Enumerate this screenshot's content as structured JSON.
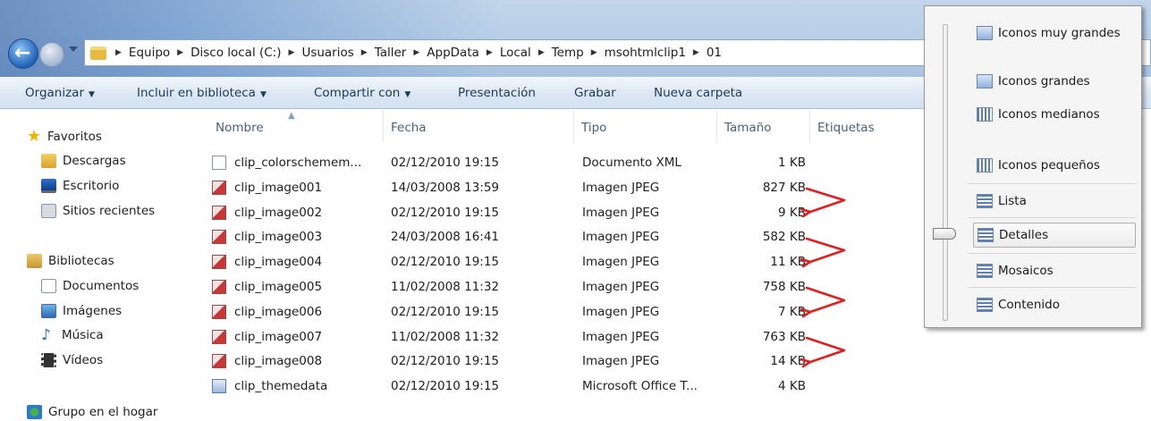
{
  "address": {
    "crumbs": [
      "Equipo",
      "Disco local (C:)",
      "Usuarios",
      "Taller",
      "AppData",
      "Local",
      "Temp",
      "msohtmlclip1",
      "01"
    ]
  },
  "toolbar": {
    "organize": "Organizar",
    "include": "Incluir en biblioteca",
    "share": "Compartir con",
    "presentation": "Presentación",
    "burn": "Grabar",
    "new_folder": "Nueva carpeta"
  },
  "nav": {
    "favorites": "Favoritos",
    "downloads": "Descargas",
    "desktop": "Escritorio",
    "recent": "Sitios recientes",
    "libraries": "Bibliotecas",
    "documents": "Documentos",
    "images": "Imágenes",
    "music": "Música",
    "videos": "Vídeos",
    "homegroup": "Grupo en el hogar"
  },
  "columns": {
    "name": "Nombre",
    "date": "Fecha",
    "type": "Tipo",
    "size": "Tamaño",
    "tags": "Etiquetas"
  },
  "files": [
    {
      "name": "clip_colorschemem...",
      "date": "02/12/2010 19:15",
      "type": "Documento XML",
      "size": "1 KB",
      "icon": "xml-file-icon"
    },
    {
      "name": "clip_image001",
      "date": "14/03/2008 13:59",
      "type": "Imagen JPEG",
      "size": "827 KB",
      "icon": "jpeg-file-icon"
    },
    {
      "name": "clip_image002",
      "date": "02/12/2010 19:15",
      "type": "Imagen JPEG",
      "size": "9 KB",
      "icon": "jpeg-file-icon"
    },
    {
      "name": "clip_image003",
      "date": "24/03/2008 16:41",
      "type": "Imagen JPEG",
      "size": "582 KB",
      "icon": "jpeg-file-icon"
    },
    {
      "name": "clip_image004",
      "date": "02/12/2010 19:15",
      "type": "Imagen JPEG",
      "size": "11 KB",
      "icon": "jpeg-file-icon"
    },
    {
      "name": "clip_image005",
      "date": "11/02/2008 11:32",
      "type": "Imagen JPEG",
      "size": "758 KB",
      "icon": "jpeg-file-icon"
    },
    {
      "name": "clip_image006",
      "date": "02/12/2010 19:15",
      "type": "Imagen JPEG",
      "size": "7 KB",
      "icon": "jpeg-file-icon"
    },
    {
      "name": "clip_image007",
      "date": "11/02/2008 11:32",
      "type": "Imagen JPEG",
      "size": "763 KB",
      "icon": "jpeg-file-icon"
    },
    {
      "name": "clip_image008",
      "date": "02/12/2010 19:15",
      "type": "Imagen JPEG",
      "size": "14 KB",
      "icon": "jpeg-file-icon"
    },
    {
      "name": "clip_themedata",
      "date": "02/12/2010 19:15",
      "type": "Microsoft Office T...",
      "size": "4 KB",
      "icon": "theme-file-icon"
    }
  ],
  "view_menu": {
    "extra_large": "Iconos muy grandes",
    "large": "Iconos grandes",
    "medium": "Iconos medianos",
    "small": "Iconos pequeños",
    "list": "Lista",
    "details": "Detalles",
    "tiles": "Mosaicos",
    "content": "Contenido",
    "selected": "Detalles"
  },
  "colors": {
    "annotation_arrow": "#e02020",
    "toolbar_text": "#1e395b"
  }
}
